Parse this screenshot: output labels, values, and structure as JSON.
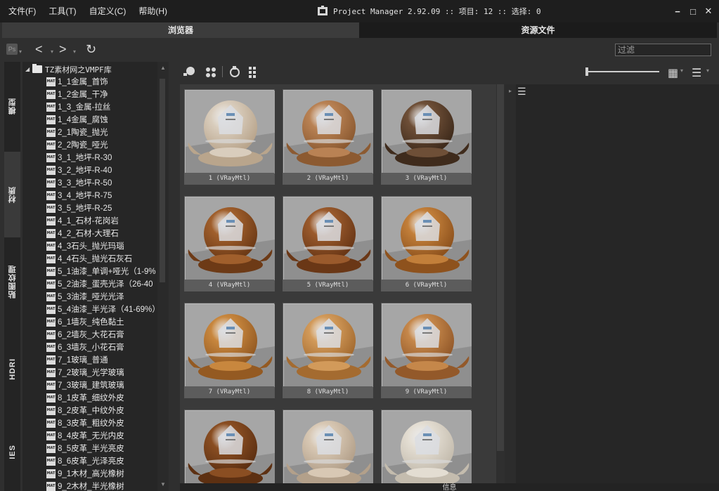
{
  "menu": [
    "文件(F)",
    "工具(T)",
    "自定义(C)",
    "帮助(H)"
  ],
  "app_title": "Project Manager 2.92.09  :: 项目: 12  :: 选择: 0",
  "window_controls": [
    "−",
    "□",
    "✕"
  ],
  "top_tabs": [
    {
      "label": "浏览器",
      "active": true
    },
    {
      "label": "资源文件",
      "active": false
    }
  ],
  "toolbar": {
    "ps_badge": "Ps",
    "back": "<",
    "forward": ">",
    "refresh": "↻",
    "filter_placeholder": "过滤"
  },
  "side_tabs": [
    {
      "label": "模型",
      "active": false
    },
    {
      "label": "材质",
      "active": true
    },
    {
      "label": "贴图纹理",
      "active": false
    },
    {
      "label": "HDRI",
      "active": false
    },
    {
      "label": "IES",
      "active": false
    }
  ],
  "tree": {
    "root": "TZ素材网之VMPF库",
    "mat_icon_text": "MAT",
    "items": [
      "1_1金属_首饰",
      "1_2金属_干净",
      "1_3_金属-拉丝",
      "1_4金属_腐蚀",
      "2_1陶瓷_抛光",
      "2_2陶瓷_哑光",
      "3_1_地坪-R-30",
      "3_2_地坪-R-40",
      "3_3_地坪-R-50",
      "3_4_地坪-R-75",
      "3_5_地坪-R-25",
      "4_1_石材-花岗岩",
      "4_2_石材-大理石",
      "4_3石头_抛光玛瑙",
      "4_4石头_抛光石灰石",
      "5_1油漆_单调+哑光（1-9%",
      "5_2油漆_蛋壳光泽（26-40",
      "5_3油漆_哑光光泽",
      "5_4油漆_半光泽（41-69%）",
      "6_1墙灰_纯色黏土",
      "6_2墙灰_大花石膏",
      "6_3墙灰_小花石膏",
      "7_1玻璃_普通",
      "7_2玻璃_光学玻璃",
      "7_3玻璃_建筑玻璃",
      "8_1皮革_细纹外皮",
      "8_2皮革_中纹外皮",
      "8_3皮革_粗纹外皮",
      "8_4皮革_无光内皮",
      "8_5皮革_半光亮皮",
      "8_6皮革_光泽亮皮",
      "9_1木材_高光橡树",
      "9_2木材_半光橡树"
    ]
  },
  "thumbnails": [
    {
      "caption": "1 (VRayMtl)",
      "color": "#d9cdbd",
      "accent": "#b9a58c"
    },
    {
      "caption": "2 (VRayMtl)",
      "color": "#b98254",
      "accent": "#8c5a31"
    },
    {
      "caption": "3 (VRayMtl)",
      "color": "#6e4f37",
      "accent": "#3f2b1c"
    },
    {
      "caption": "4 (VRayMtl)",
      "color": "#a05f2c",
      "accent": "#6d3a16"
    },
    {
      "caption": "5 (VRayMtl)",
      "color": "#9a5a2c",
      "accent": "#6a3716"
    },
    {
      "caption": "6 (VRayMtl)",
      "color": "#c27f3a",
      "accent": "#8e521d"
    },
    {
      "caption": "7 (VRayMtl)",
      "color": "#c8873e",
      "accent": "#945a22"
    },
    {
      "caption": "8 (VRayMtl)",
      "color": "#d29a5a",
      "accent": "#a46b30"
    },
    {
      "caption": "9 (VRayMtl)",
      "color": "#c5874a",
      "accent": "#93592a"
    },
    {
      "caption": "",
      "color": "#8a4e22",
      "accent": "#5d3012"
    },
    {
      "caption": "",
      "color": "#d8c8b4",
      "accent": "#b3a08a"
    },
    {
      "caption": "",
      "color": "#e3ddd2",
      "accent": "#c4bcae"
    }
  ],
  "info_label": "信息"
}
